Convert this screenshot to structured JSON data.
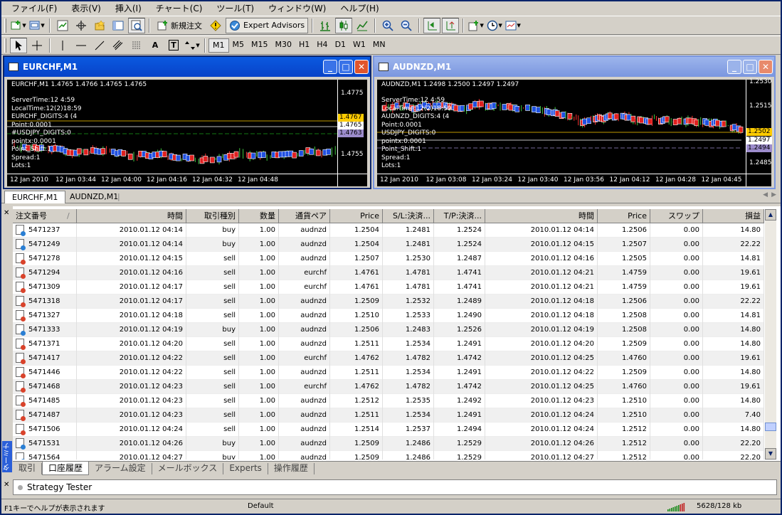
{
  "menu": [
    "ファイル(F)",
    "表示(V)",
    "挿入(I)",
    "チャート(C)",
    "ツール(T)",
    "ウィンドウ(W)",
    "ヘルプ(H)"
  ],
  "toolbar": {
    "new_order": "新規注文",
    "expert_advisors": "Expert Advisors"
  },
  "timeframes": [
    "M1",
    "M5",
    "M15",
    "M30",
    "H1",
    "H4",
    "D1",
    "W1",
    "MN"
  ],
  "tools": [
    "A",
    "T"
  ],
  "charts": [
    {
      "title": "EURCHF,M1",
      "header": "EURCHF,M1  1.4765 1.4766 1.4765 1.4765",
      "info": [
        "ServerTime:12 4:59",
        "LocalTime:12(2)18:59",
        "EURCHF_DIGITS:4 (4",
        "Point:0.0001",
        "#USDJPY_DIGITS:0",
        "pointx:0.0001",
        "Point_Shift:1",
        "Spread:1",
        "Lots:1"
      ],
      "yticks": [
        "1.4775",
        "1.4755"
      ],
      "price_labels": [
        {
          "text": "1.4767",
          "color": "#ffcc00"
        },
        {
          "text": "1.4765",
          "color": "#ffffff"
        },
        {
          "text": "1.4763",
          "color": "#9c8ccc"
        }
      ],
      "xticks": [
        "12 Jan 2010",
        "12 Jan 03:44",
        "12 Jan 04:00",
        "12 Jan 04:16",
        "12 Jan 04:32",
        "12 Jan 04:48"
      ]
    },
    {
      "title": "AUDNZD,M1",
      "header": "AUDNZD,M1  1.2498 1.2500 1.2497 1.2497",
      "info": [
        "ServerTime:12 4:59",
        "LocalTime:12(2)18:59",
        "AUDNZD_DIGITS:4 (4",
        "Point:0.0001",
        "USDJPY_DIGITS:0",
        "pointx:0.0001",
        "Point_Shift:1",
        "Spread:1",
        "Lots:1"
      ],
      "yticks": [
        "1.2530",
        "1.2515",
        "1.2485"
      ],
      "price_labels": [
        {
          "text": "1.2502",
          "color": "#ffcc00"
        },
        {
          "text": "1.2497",
          "color": "#ffffff"
        },
        {
          "text": "1.2494",
          "color": "#9c8ccc"
        }
      ],
      "xticks": [
        "12 Jan 2010",
        "12 Jan 03:08",
        "12 Jan 03:24",
        "12 Jan 03:40",
        "12 Jan 03:56",
        "12 Jan 04:12",
        "12 Jan 04:28",
        "12 Jan 04:45"
      ]
    }
  ],
  "chart_tabs": [
    "EURCHF,M1",
    "AUDNZD,M1"
  ],
  "terminal": {
    "side_label": "ターミナル",
    "columns": [
      "注文番号",
      "時間",
      "取引種別",
      "数量",
      "通貨ペア",
      "Price",
      "S/L:決済...",
      "T/P:決済...",
      "時間",
      "Price",
      "スワップ",
      "損益"
    ],
    "sort_marker": "/",
    "rows": [
      [
        "5471237",
        "2010.01.12 04:14",
        "buy",
        "1.00",
        "audnzd",
        "1.2504",
        "1.2481",
        "1.2524",
        "2010.01.12 04:14",
        "1.2506",
        "0.00",
        "14.80"
      ],
      [
        "5471249",
        "2010.01.12 04:14",
        "buy",
        "1.00",
        "audnzd",
        "1.2504",
        "1.2481",
        "1.2524",
        "2010.01.12 04:15",
        "1.2507",
        "0.00",
        "22.22"
      ],
      [
        "5471278",
        "2010.01.12 04:15",
        "sell",
        "1.00",
        "audnzd",
        "1.2507",
        "1.2530",
        "1.2487",
        "2010.01.12 04:16",
        "1.2505",
        "0.00",
        "14.81"
      ],
      [
        "5471294",
        "2010.01.12 04:16",
        "sell",
        "1.00",
        "eurchf",
        "1.4761",
        "1.4781",
        "1.4741",
        "2010.01.12 04:21",
        "1.4759",
        "0.00",
        "19.61"
      ],
      [
        "5471309",
        "2010.01.12 04:17",
        "sell",
        "1.00",
        "eurchf",
        "1.4761",
        "1.4781",
        "1.4741",
        "2010.01.12 04:21",
        "1.4759",
        "0.00",
        "19.61"
      ],
      [
        "5471318",
        "2010.01.12 04:17",
        "sell",
        "1.00",
        "audnzd",
        "1.2509",
        "1.2532",
        "1.2489",
        "2010.01.12 04:18",
        "1.2506",
        "0.00",
        "22.22"
      ],
      [
        "5471327",
        "2010.01.12 04:18",
        "sell",
        "1.00",
        "audnzd",
        "1.2510",
        "1.2533",
        "1.2490",
        "2010.01.12 04:18",
        "1.2508",
        "0.00",
        "14.81"
      ],
      [
        "5471333",
        "2010.01.12 04:19",
        "buy",
        "1.00",
        "audnzd",
        "1.2506",
        "1.2483",
        "1.2526",
        "2010.01.12 04:19",
        "1.2508",
        "0.00",
        "14.80"
      ],
      [
        "5471371",
        "2010.01.12 04:20",
        "sell",
        "1.00",
        "audnzd",
        "1.2511",
        "1.2534",
        "1.2491",
        "2010.01.12 04:20",
        "1.2509",
        "0.00",
        "14.80"
      ],
      [
        "5471417",
        "2010.01.12 04:22",
        "sell",
        "1.00",
        "eurchf",
        "1.4762",
        "1.4782",
        "1.4742",
        "2010.01.12 04:25",
        "1.4760",
        "0.00",
        "19.61"
      ],
      [
        "5471446",
        "2010.01.12 04:22",
        "sell",
        "1.00",
        "audnzd",
        "1.2511",
        "1.2534",
        "1.2491",
        "2010.01.12 04:22",
        "1.2509",
        "0.00",
        "14.80"
      ],
      [
        "5471468",
        "2010.01.12 04:23",
        "sell",
        "1.00",
        "eurchf",
        "1.4762",
        "1.4782",
        "1.4742",
        "2010.01.12 04:25",
        "1.4760",
        "0.00",
        "19.61"
      ],
      [
        "5471485",
        "2010.01.12 04:23",
        "sell",
        "1.00",
        "audnzd",
        "1.2512",
        "1.2535",
        "1.2492",
        "2010.01.12 04:23",
        "1.2510",
        "0.00",
        "14.80"
      ],
      [
        "5471487",
        "2010.01.12 04:23",
        "sell",
        "1.00",
        "audnzd",
        "1.2511",
        "1.2534",
        "1.2491",
        "2010.01.12 04:24",
        "1.2510",
        "0.00",
        "7.40"
      ],
      [
        "5471506",
        "2010.01.12 04:24",
        "sell",
        "1.00",
        "audnzd",
        "1.2514",
        "1.2537",
        "1.2494",
        "2010.01.12 04:24",
        "1.2512",
        "0.00",
        "14.80"
      ],
      [
        "5471531",
        "2010.01.12 04:26",
        "buy",
        "1.00",
        "audnzd",
        "1.2509",
        "1.2486",
        "1.2529",
        "2010.01.12 04:26",
        "1.2512",
        "0.00",
        "22.20"
      ],
      [
        "5471564",
        "2010.01.12 04:27",
        "buy",
        "1.00",
        "audnzd",
        "1.2509",
        "1.2486",
        "1.2529",
        "2010.01.12 04:27",
        "1.2512",
        "0.00",
        "22.20"
      ]
    ],
    "tabs": [
      "取引",
      "口座履歴",
      "アラーム設定",
      "メールボックス",
      "Experts",
      "操作履歴"
    ],
    "active_tab": 1
  },
  "tester": "Strategy Tester",
  "status": {
    "help": "F1キーでヘルプが表示されます",
    "profile": "Default",
    "memory": "5628/128 kb"
  },
  "colors": {
    "buy": "#2a7fd4",
    "sell": "#d9432b",
    "bull": "#3ec83e",
    "bear": "#ff3030"
  }
}
